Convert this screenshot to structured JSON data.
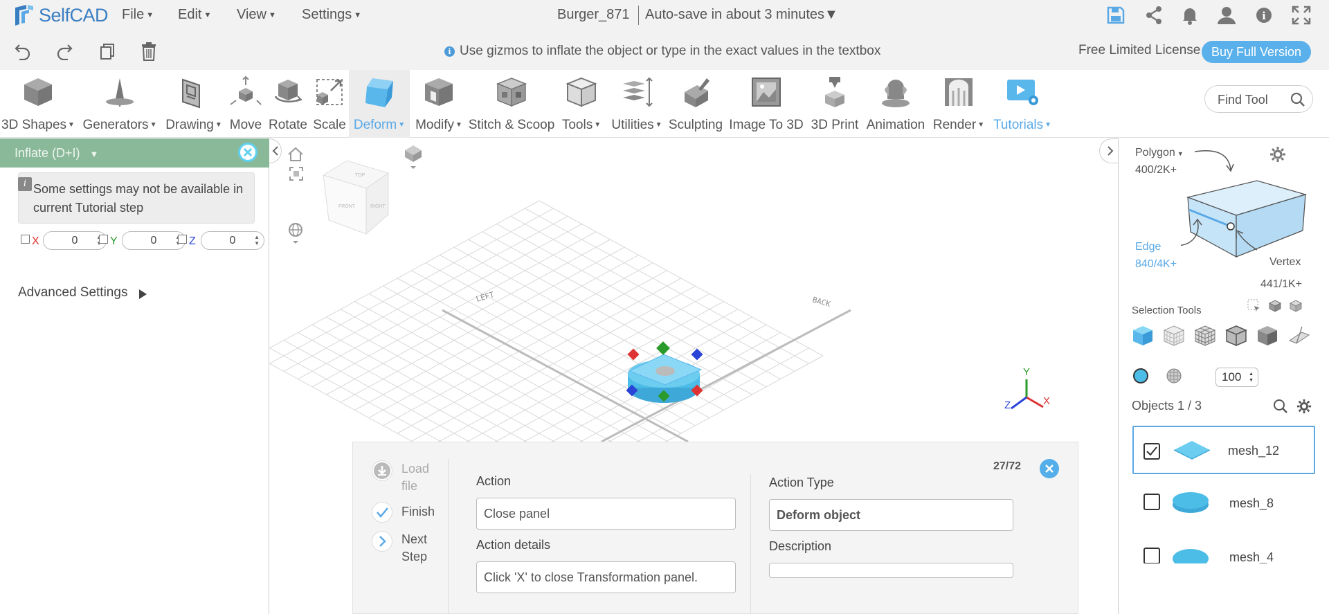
{
  "app": {
    "logo_text": "SelfCAD",
    "menus": [
      "File",
      "Edit",
      "View",
      "Settings"
    ],
    "document_title": "Burger_871",
    "autosave": "Auto-save in about 3 minutes"
  },
  "hint_bar": {
    "hint": "Use gizmos to inflate the object or type in the exact values in the textbox",
    "license": "Free Limited License",
    "buy_button": "Buy Full Version"
  },
  "toolbar": {
    "tools": [
      {
        "label": "3D Shapes",
        "dropdown": true
      },
      {
        "label": "Generators",
        "dropdown": true
      },
      {
        "label": "Drawing",
        "dropdown": true
      },
      {
        "label": "Move",
        "dropdown": false
      },
      {
        "label": "Rotate",
        "dropdown": false
      },
      {
        "label": "Scale",
        "dropdown": false
      },
      {
        "label": "Deform",
        "dropdown": true
      },
      {
        "label": "Modify",
        "dropdown": true
      },
      {
        "label": "Stitch & Scoop",
        "dropdown": false
      },
      {
        "label": "Tools",
        "dropdown": true
      },
      {
        "label": "Utilities",
        "dropdown": true
      },
      {
        "label": "Sculpting",
        "dropdown": false
      },
      {
        "label": "Image To 3D",
        "dropdown": false
      },
      {
        "label": "3D Print",
        "dropdown": false
      },
      {
        "label": "Animation",
        "dropdown": false
      },
      {
        "label": "Render",
        "dropdown": true
      },
      {
        "label": "Tutorials",
        "dropdown": true
      }
    ],
    "find_tool_placeholder": "Find Tool"
  },
  "left_panel": {
    "title": "Inflate (D+I)",
    "note": "Some settings may not be available in current Tutorial step",
    "axes": [
      {
        "label": "X",
        "value": "0",
        "color": "#e02b2b"
      },
      {
        "label": "Y",
        "value": "0",
        "color": "#2a9a2a"
      },
      {
        "label": "Z",
        "value": "0",
        "color": "#2b44d8"
      }
    ],
    "advanced_settings": "Advanced Settings"
  },
  "viewport": {
    "cube_faces": {
      "top": "TOP",
      "front": "FRONT",
      "right": "RIGHT"
    },
    "grid_labels": {
      "left": "LEFT",
      "back": "BACK"
    },
    "axis_labels": {
      "y": "Y",
      "x": "X",
      "z": "Z"
    }
  },
  "tutorial": {
    "load_file": "Load file",
    "finish": "Finish",
    "next_step": "Next Step",
    "progress": "27/72",
    "action_label": "Action",
    "action_value": "Close panel",
    "action_details_label": "Action details",
    "action_details_value": "Click 'X' to close Transformation panel.",
    "action_type_label": "Action Type",
    "action_type_value": "Deform object",
    "description_label": "Description",
    "description_value": ""
  },
  "right_panel": {
    "polygon_label": "Polygon",
    "polygon_count": "400/2K+",
    "edge_label": "Edge",
    "edge_count": "840/4K+",
    "vertex_label": "Vertex",
    "vertex_count": "441/1K+",
    "selection_tools": "Selection Tools",
    "brush_size": "100",
    "objects_label": "Objects 1 / 3",
    "objects": [
      {
        "name": "mesh_12",
        "checked": true,
        "selected": true
      },
      {
        "name": "mesh_8",
        "checked": false,
        "selected": false
      },
      {
        "name": "mesh_4",
        "checked": false,
        "selected": false
      }
    ]
  },
  "colors": {
    "accent": "#5aa9e6",
    "panel_header": "#8ab99a",
    "object_blue": "#4cbde6"
  }
}
